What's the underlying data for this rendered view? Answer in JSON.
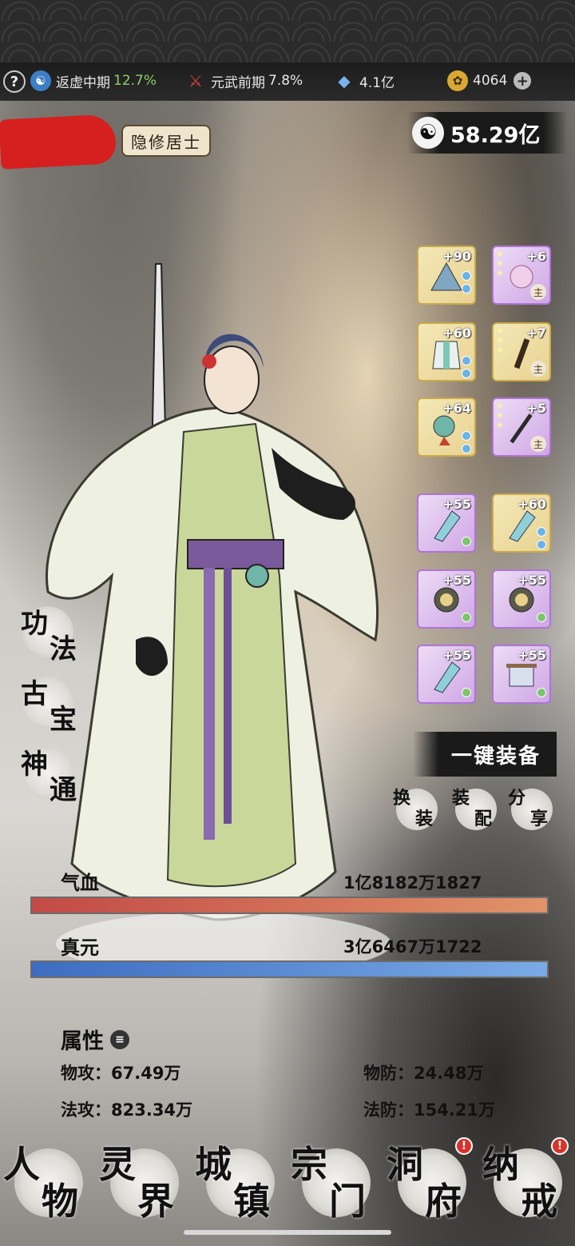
{
  "topbar": {
    "help": "?",
    "realm": {
      "label": "返虚中期",
      "percent": "12.7%"
    },
    "martial": {
      "label": "元武前期",
      "percent": "7.8%"
    },
    "crystal": {
      "amount": "4.1亿"
    },
    "currency": {
      "amount": "4064",
      "plus": "+"
    }
  },
  "profile": {
    "title": "隐修居士",
    "power": "58.29亿"
  },
  "equipment": {
    "top": [
      {
        "level": "+90",
        "quality": "gold",
        "main": false
      },
      {
        "level": "+6",
        "quality": "purple",
        "main": true
      },
      {
        "level": "+60",
        "quality": "gold",
        "main": false
      },
      {
        "level": "+7",
        "quality": "gold",
        "main": true
      },
      {
        "level": "+64",
        "quality": "gold",
        "main": false
      },
      {
        "level": "+5",
        "quality": "purple",
        "main": true
      }
    ],
    "bottom": [
      {
        "level": "+55",
        "quality": "purple"
      },
      {
        "level": "+60",
        "quality": "gold"
      },
      {
        "level": "+55",
        "quality": "purple"
      },
      {
        "level": "+55",
        "quality": "purple"
      },
      {
        "level": "+55",
        "quality": "purple"
      },
      {
        "level": "+55",
        "quality": "purple"
      }
    ],
    "main_mark": "主"
  },
  "left_menu": [
    {
      "a": "功",
      "b": "法"
    },
    {
      "a": "古",
      "b": "宝"
    },
    {
      "a": "神",
      "b": "通"
    }
  ],
  "actions": {
    "one_key": "一键装备",
    "swap": {
      "a": "换",
      "b": "装"
    },
    "match": {
      "a": "装",
      "b": "配"
    },
    "share": {
      "a": "分",
      "b": "享"
    }
  },
  "bars": {
    "hp": {
      "label": "气血",
      "value": "1亿8182万1827",
      "fill": 1.0,
      "color": "#c85a50"
    },
    "mp": {
      "label": "真元",
      "value": "3亿6467万1722",
      "fill": 1.0,
      "color": "#4a78c4"
    }
  },
  "attributes": {
    "title": "属性",
    "phys_atk": "物攻：67.49万",
    "phys_def": "物防：24.48万",
    "mag_atk": "法攻：823.34万",
    "mag_def": "法防：154.21万"
  },
  "nav": [
    {
      "a": "人",
      "b": "物",
      "badge": false
    },
    {
      "a": "灵",
      "b": "界",
      "badge": false
    },
    {
      "a": "城",
      "b": "镇",
      "badge": false
    },
    {
      "a": "宗",
      "b": "门",
      "badge": false
    },
    {
      "a": "洞",
      "b": "府",
      "badge": true
    },
    {
      "a": "纳",
      "b": "戒",
      "badge": true
    }
  ],
  "badge_text": "!"
}
